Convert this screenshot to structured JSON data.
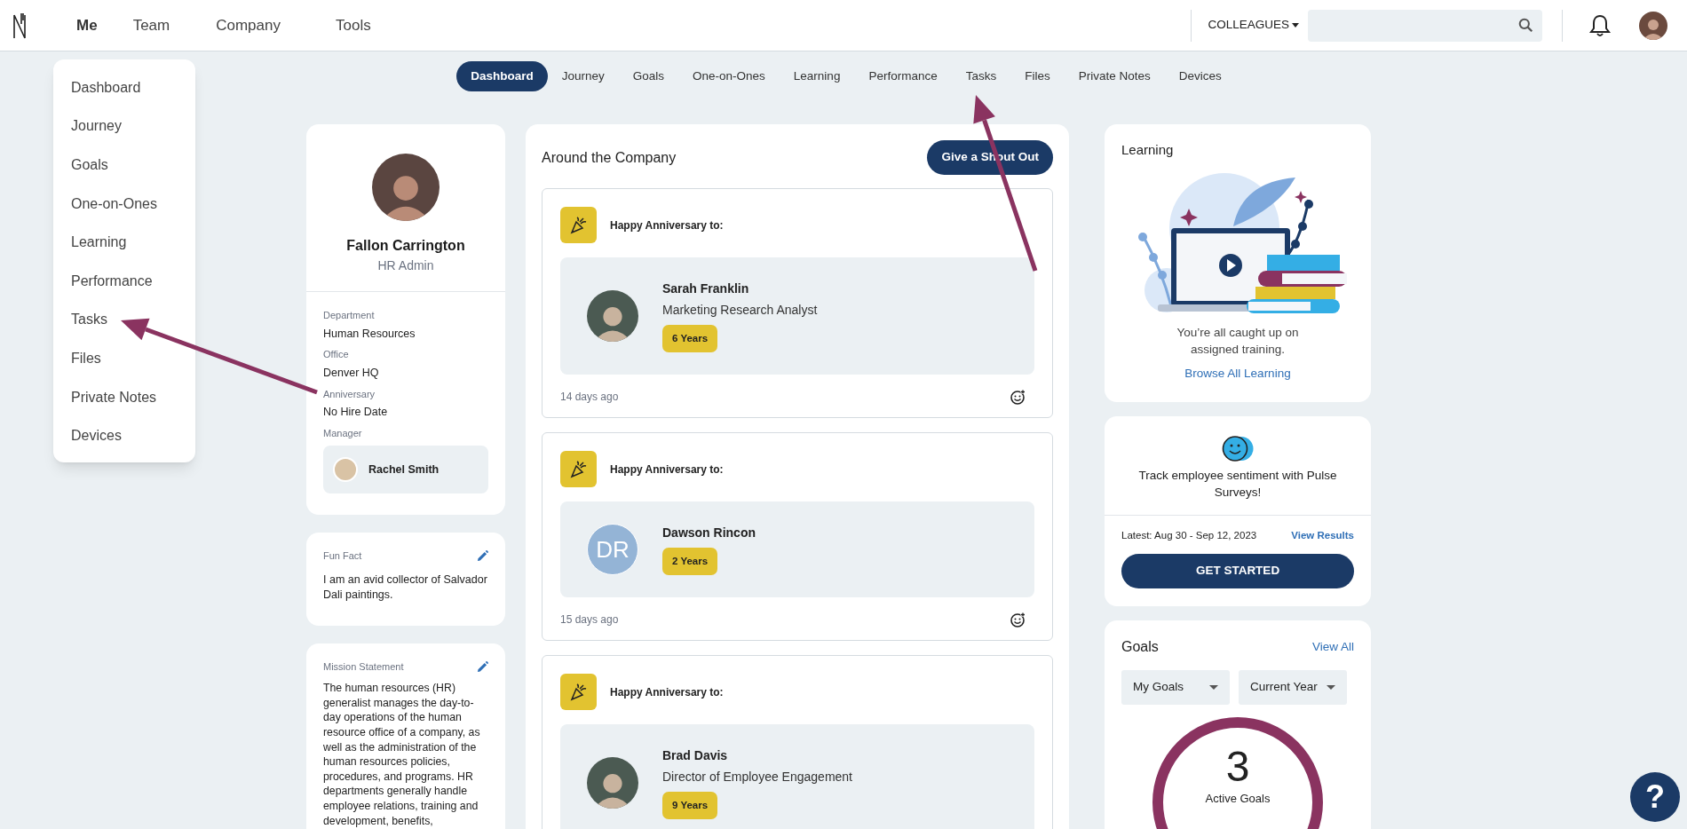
{
  "top_nav": {
    "items": [
      {
        "label": "Me",
        "selected": true
      },
      {
        "label": "Team",
        "selected": false
      },
      {
        "label": "Company",
        "selected": false
      },
      {
        "label": "Tools",
        "selected": false
      }
    ],
    "colleagues_menu": "COLLEAGUES"
  },
  "me_menu": {
    "items": [
      "Dashboard",
      "Journey",
      "Goals",
      "One-on-Ones",
      "Learning",
      "Performance",
      "Tasks",
      "Files",
      "Private Notes",
      "Devices"
    ]
  },
  "sub_tabs": [
    {
      "label": "Dashboard",
      "selected": true
    },
    {
      "label": "Journey",
      "selected": false
    },
    {
      "label": "Goals",
      "selected": false
    },
    {
      "label": "One-on-Ones",
      "selected": false
    },
    {
      "label": "Learning",
      "selected": false
    },
    {
      "label": "Performance",
      "selected": false
    },
    {
      "label": "Tasks",
      "selected": false
    },
    {
      "label": "Files",
      "selected": false
    },
    {
      "label": "Private Notes",
      "selected": false
    },
    {
      "label": "Devices",
      "selected": false
    }
  ],
  "profile": {
    "name": "Fallon Carrington",
    "title": "HR Admin",
    "fields": [
      {
        "label": "Department",
        "value": "Human Resources"
      },
      {
        "label": "Office",
        "value": "Denver HQ"
      },
      {
        "label": "Anniversary",
        "value": "No Hire Date"
      }
    ],
    "manager_label": "Manager",
    "manager": "Rachel Smith"
  },
  "fun_fact": {
    "label": "Fun Fact",
    "text": "I am an avid collector of Salvador Dali paintings."
  },
  "mission": {
    "label": "Mission Statement",
    "text": "The human resources (HR) generalist manages the day-to-day operations of the human resource office of a company, as well as the administration of the human resources policies, procedures, and programs. HR departments generally handle employee relations, training and development, benefits,"
  },
  "feed": {
    "title": "Around the Company",
    "action": "Give a Shout Out",
    "posts": [
      {
        "heading": "Happy Anniversary to:",
        "avatar": {
          "kind": "photo"
        },
        "name": "Sarah Franklin",
        "role": "Marketing Research Analyst",
        "badge": "6 Years",
        "time": "14 days ago"
      },
      {
        "heading": "Happy Anniversary to:",
        "avatar": {
          "kind": "initials",
          "initials": "DR"
        },
        "name": "Dawson Rincon",
        "badge": "2 Years",
        "time": "15 days ago"
      },
      {
        "heading": "Happy Anniversary to:",
        "avatar": {
          "kind": "photo"
        },
        "name": "Brad Davis",
        "role": "Director of Employee Engagement",
        "badge": "9 Years"
      }
    ]
  },
  "learning": {
    "title": "Learning",
    "message": "You’re all caught up on assigned training.",
    "link": "Browse All Learning"
  },
  "pulse": {
    "message": "Track employee sentiment with Pulse Surveys!",
    "latest": "Latest: Aug 30 - Sep 12, 2023",
    "link": "View Results",
    "action": "GET STARTED"
  },
  "goals": {
    "title": "Goals",
    "link": "View All",
    "filters": [
      "My Goals",
      "Current Year"
    ],
    "count": "3",
    "count_label": "Active Goals"
  },
  "help_button": "?"
}
